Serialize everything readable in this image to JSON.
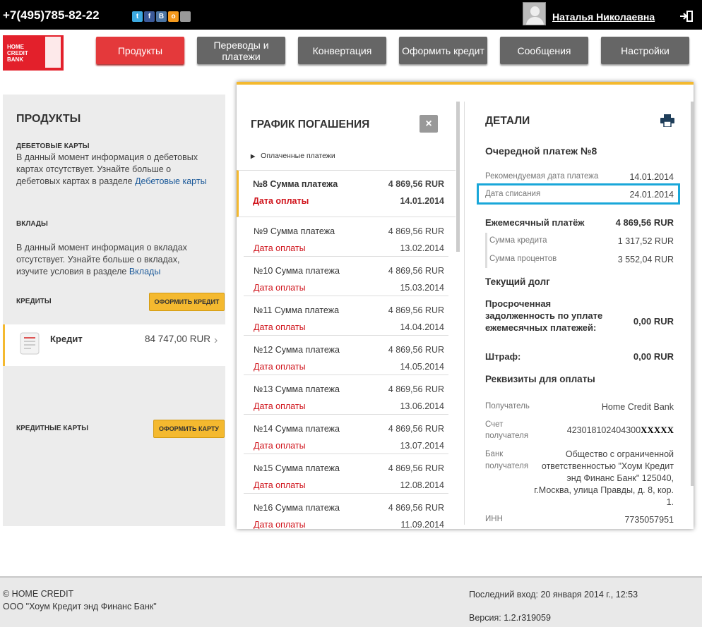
{
  "topbar": {
    "phone": "+7(495)785-82-22",
    "social": [
      "twitter-icon",
      "facebook-icon",
      "vkontakte-icon",
      "odnoklassniki-icon",
      "apple-icon"
    ],
    "user_name": "Наталья Николаевна"
  },
  "logo": {
    "text": "HOME CREDIT BANK"
  },
  "nav": [
    {
      "label": "Продукты",
      "active": true
    },
    {
      "label": "Переводы и платежи"
    },
    {
      "label": "Конвертация"
    },
    {
      "label": "Оформить кредит"
    },
    {
      "label": "Сообщения"
    },
    {
      "label": "Настройки"
    }
  ],
  "products": {
    "title": "ПРОДУКТЫ",
    "debit_heading": "ДЕБЕТОВЫЕ КАРТЫ",
    "debit_text": "В данный момент информация о дебетовых картах отсутствует. Узнайте больше о дебетовых картах в разделе ",
    "debit_link": "Дебетовые карты",
    "deposits_heading": "ВКЛАДЫ",
    "deposits_text": "В данный момент информация о вкладах отсутствует. Узнайте больше о вкладах, изучите условия в разделе ",
    "deposits_link": "Вклады",
    "credits_heading": "КРЕДИТЫ",
    "credits_button": "ОФОРМИТЬ КРЕДИТ",
    "credit_item": {
      "name": "Кредит",
      "amount": "84 747,00 RUR"
    },
    "cards_heading": "КРЕДИТНЫЕ КАРТЫ",
    "cards_button": "ОФОРМИТЬ КАРТУ"
  },
  "schedule": {
    "title": "ГРАФИК ПОГАШЕНИЯ",
    "close": "×",
    "paid_label": "Оплаченные платежи",
    "rows": [
      {
        "label": "№8 Сумма платежа",
        "amount": "4 869,56 RUR",
        "date_label": "Дата оплаты",
        "date": "14.01.2014"
      },
      {
        "label": "№9 Сумма платежа",
        "amount": "4 869,56 RUR",
        "date_label": "Дата оплаты",
        "date": "13.02.2014"
      },
      {
        "label": "№10 Сумма платежа",
        "amount": "4 869,56 RUR",
        "date_label": "Дата оплаты",
        "date": "15.03.2014"
      },
      {
        "label": "№11 Сумма платежа",
        "amount": "4 869,56 RUR",
        "date_label": "Дата оплаты",
        "date": "14.04.2014"
      },
      {
        "label": "№12 Сумма платежа",
        "amount": "4 869,56 RUR",
        "date_label": "Дата оплаты",
        "date": "14.05.2014"
      },
      {
        "label": "№13 Сумма платежа",
        "amount": "4 869,56 RUR",
        "date_label": "Дата оплаты",
        "date": "13.06.2014"
      },
      {
        "label": "№14 Сумма платежа",
        "amount": "4 869,56 RUR",
        "date_label": "Дата оплаты",
        "date": "13.07.2014"
      },
      {
        "label": "№15 Сумма платежа",
        "amount": "4 869,56 RUR",
        "date_label": "Дата оплаты",
        "date": "12.08.2014"
      },
      {
        "label": "№16 Сумма платежа",
        "amount": "4 869,56 RUR",
        "date_label": "Дата оплаты",
        "date": "11.09.2014"
      }
    ]
  },
  "details": {
    "title": "ДЕТАЛИ",
    "next_payment": "Очередной платеж №8",
    "recommended_date_label": "Рекомендуемая дата платежа",
    "recommended_date": "14.01.2014",
    "debit_date_label": "Дата списания",
    "debit_date": "24.01.2014",
    "monthly_label": "Ежемесячный платёж",
    "monthly_value": "4 869,56 RUR",
    "credit_sum_label": "Сумма кредита",
    "credit_sum": "1 317,52 RUR",
    "interest_label": "Сумма процентов",
    "interest": "3 552,04 RUR",
    "current_debt": "Текущий долг",
    "overdue_label": "Просроченная задолженность по уплате ежемесячных платежей:",
    "overdue_value": "0,00 RUR",
    "fine_label": "Штраф:",
    "fine_value": "0,00 RUR",
    "requisites": "Реквизиты для оплаты",
    "recipient_label": "Получатель",
    "recipient": "Home Credit Bank",
    "account_label": "Счет получателя",
    "account": "423018102404300",
    "account_mask": "XXXXX",
    "bank_label": "Банк получателя",
    "bank": "Общество с ограниченной ответственностью \"Хоум Кредит энд Финанс Банк\" 125040, г.Москва, улица Правды, д. 8, кор. 1.",
    "inn_label": "ИНН",
    "inn": "7735057951"
  },
  "footer": {
    "copyright": "© HOME CREDIT",
    "company": "ООО \"Хоум Кредит энд Финанс Банк\"",
    "last_login": "Последний вход: 20 января 2014 г., 12:53",
    "version": "Версия: 1.2.r319059"
  },
  "colors": {
    "brand_red": "#e3202b",
    "accent_yellow": "#f4b92f",
    "highlight_blue": "#19a7d9",
    "date_red": "#d0141c"
  }
}
